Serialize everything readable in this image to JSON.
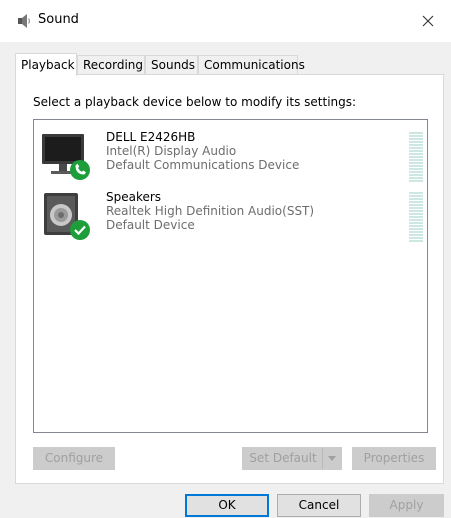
{
  "window": {
    "title": "Sound"
  },
  "tabs": [
    {
      "label": "Playback",
      "active": true
    },
    {
      "label": "Recording",
      "active": false
    },
    {
      "label": "Sounds",
      "active": false
    },
    {
      "label": "Communications",
      "active": false
    }
  ],
  "playback": {
    "instruction": "Select a playback device below to modify its settings:",
    "devices": [
      {
        "name": "DELL E2426HB",
        "driver": "Intel(R) Display Audio",
        "status": "Default Communications Device",
        "icon": "monitor-icon",
        "badge": "phone-badge-icon"
      },
      {
        "name": "Speakers",
        "driver": "Realtek High Definition Audio(SST)",
        "status": "Default Device",
        "icon": "speaker-icon",
        "badge": "check-badge-icon"
      }
    ],
    "buttons": {
      "configure": "Configure",
      "set_default": "Set Default",
      "properties": "Properties"
    }
  },
  "dialog_buttons": {
    "ok": "OK",
    "cancel": "Cancel",
    "apply": "Apply"
  },
  "colors": {
    "accent": "#0078d7",
    "badge_green": "#1e9e3a",
    "meter": "#cde7e3",
    "disabled_text": "#a0a0a0"
  }
}
